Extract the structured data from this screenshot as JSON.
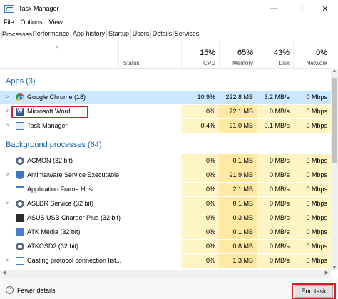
{
  "window": {
    "title": "Task Manager",
    "controls": {
      "minimize": "—",
      "maximize": "☐",
      "close": "✕"
    }
  },
  "menu": [
    "File",
    "Options",
    "View"
  ],
  "tabs": [
    {
      "label": "Processes",
      "active": true
    },
    {
      "label": "Performance",
      "active": false
    },
    {
      "label": "App history",
      "active": false
    },
    {
      "label": "Startup",
      "active": false
    },
    {
      "label": "Users",
      "active": false
    },
    {
      "label": "Details",
      "active": false
    },
    {
      "label": "Services",
      "active": false
    }
  ],
  "columns": {
    "name": "Name",
    "status": "Status",
    "cpu": {
      "pct": "15%",
      "label": "CPU"
    },
    "memory": {
      "pct": "65%",
      "label": "Memory"
    },
    "disk": {
      "pct": "43%",
      "label": "Disk"
    },
    "network": {
      "pct": "0%",
      "label": "Network"
    }
  },
  "apps": {
    "title": "Apps (3)",
    "rows": [
      {
        "name": "Google Chrome (18)",
        "icon": "chrome-icon",
        "cpu": "10.9%",
        "memory": "222.8 MB",
        "disk": "3.2 MB/s",
        "network": "0 Mbps",
        "selected": true
      },
      {
        "name": "Microsoft Word",
        "icon": "word-icon",
        "cpu": "0%",
        "memory": "72.1 MB",
        "disk": "0 MB/s",
        "network": "0 Mbps",
        "selected": false
      },
      {
        "name": "Task Manager",
        "icon": "task-manager-icon",
        "cpu": "0.4%",
        "memory": "21.0 MB",
        "disk": "0.1 MB/s",
        "network": "0 Mbps",
        "selected": false
      }
    ]
  },
  "background": {
    "title": "Background processes (64)",
    "rows": [
      {
        "name": "ACMON (32 bit)",
        "icon": "gear-icon",
        "cpu": "0%",
        "memory": "0.1 MB",
        "disk": "0 MB/s",
        "network": "0 Mbps"
      },
      {
        "name": "Antimalware Service Executable",
        "icon": "shield-icon",
        "cpu": "0%",
        "memory": "91.9 MB",
        "disk": "0 MB/s",
        "network": "0 Mbps"
      },
      {
        "name": "Application Frame Host",
        "icon": "window-icon",
        "cpu": "0%",
        "memory": "2.1 MB",
        "disk": "0 MB/s",
        "network": "0 Mbps"
      },
      {
        "name": "ASLDR Service (32 bit)",
        "icon": "gear-icon",
        "cpu": "0%",
        "memory": "0.1 MB",
        "disk": "0 MB/s",
        "network": "0 Mbps"
      },
      {
        "name": "ASUS USB Charger Plus (32 bit)",
        "icon": "asus-icon",
        "cpu": "0%",
        "memory": "0.3 MB",
        "disk": "0 MB/s",
        "network": "0 Mbps"
      },
      {
        "name": "ATK Media (32 bit)",
        "icon": "media-icon",
        "cpu": "0%",
        "memory": "0.1 MB",
        "disk": "0 MB/s",
        "network": "0 Mbps"
      },
      {
        "name": "ATKOSD2 (32 bit)",
        "icon": "gear-icon",
        "cpu": "0%",
        "memory": "0.8 MB",
        "disk": "0 MB/s",
        "network": "0 Mbps"
      },
      {
        "name": "Casting protocol connection list...",
        "icon": "cast-icon",
        "cpu": "0%",
        "memory": "1.3 MB",
        "disk": "0 MB/s",
        "network": "0 Mbps"
      }
    ]
  },
  "footer": {
    "fewer_details": "Fewer details",
    "end_task": "End task"
  },
  "colors": {
    "selected_row": "#cce8ff",
    "heat_low": "#fff4c4",
    "heat_mid": "#ffe9a3",
    "highlight_red": "#d41f26",
    "section_title": "#1f64a8"
  }
}
